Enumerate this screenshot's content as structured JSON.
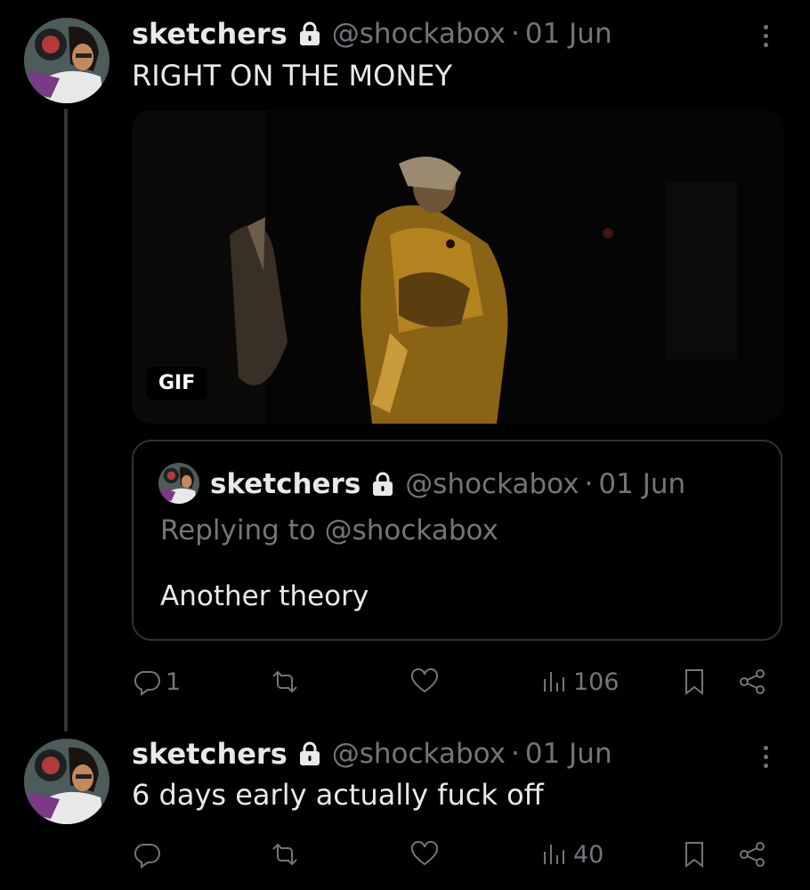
{
  "tweets": [
    {
      "name": "sketchers",
      "handle": "@shockabox",
      "separator": "·",
      "date": "01 Jun",
      "text": "RIGHT ON THE MONEY",
      "media_badge": "GIF",
      "quote": {
        "name": "sketchers",
        "handle": "@shockabox",
        "separator": "·",
        "date": "01 Jun",
        "replying_to": "Replying to @shockabox",
        "text": "Another theory"
      },
      "actions": {
        "replies": "1",
        "retweets": "",
        "likes": "",
        "views": "106"
      }
    },
    {
      "name": "sketchers",
      "handle": "@shockabox",
      "separator": "·",
      "date": "01 Jun",
      "text": "6 days early actually fuck off",
      "actions": {
        "replies": "",
        "retweets": "",
        "likes": "",
        "views": "40"
      }
    }
  ],
  "icons": {
    "lock": "lock-icon",
    "more": "more-options-icon",
    "reply": "reply-icon",
    "retweet": "retweet-icon",
    "like": "heart-icon",
    "views": "views-icon",
    "bookmark": "bookmark-icon",
    "share": "share-icon"
  },
  "colors": {
    "background": "#000000",
    "text": "#e7e9ea",
    "muted": "#71767b",
    "border": "#2f3336"
  }
}
